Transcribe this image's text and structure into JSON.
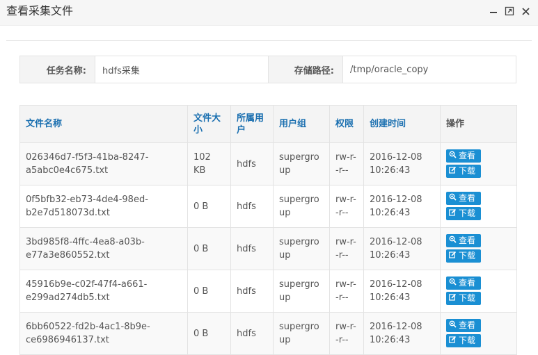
{
  "dialog": {
    "title": "查看采集文件"
  },
  "info": {
    "task_label": "任务名称:",
    "task_value": "hdfs采集",
    "path_label": "存储路径:",
    "path_value": "/tmp/oracle_copy"
  },
  "table": {
    "headers": {
      "name": "文件名称",
      "size": "文件大小",
      "owner": "所属用户",
      "group": "用户组",
      "perm": "权限",
      "ctime": "创建时间",
      "ops": "操作"
    },
    "rows": [
      {
        "name": "026346d7-f5f3-41ba-8247-a5abc0e4c675.txt",
        "size": "102 KB",
        "owner": "hdfs",
        "group": "supergroup",
        "perm": "rw-r--r--",
        "ctime": "2016-12-08 10:26:43",
        "view": "查看",
        "download": "下载"
      },
      {
        "name": "0f5bfb32-eb73-4de4-98ed-b2e7d518073d.txt",
        "size": "0 B",
        "owner": "hdfs",
        "group": "supergroup",
        "perm": "rw-r--r--",
        "ctime": "2016-12-08 10:26:43",
        "view": "查看",
        "download": "下载"
      },
      {
        "name": "3bd985f8-4ffc-4ea8-a03b-e77a3e860552.txt",
        "size": "0 B",
        "owner": "hdfs",
        "group": "supergroup",
        "perm": "rw-r--r--",
        "ctime": "2016-12-08 10:26:43",
        "view": "查看",
        "download": "下载"
      },
      {
        "name": "45916b9e-c02f-47f4-a661-e299ad274db5.txt",
        "size": "0 B",
        "owner": "hdfs",
        "group": "supergroup",
        "perm": "rw-r--r--",
        "ctime": "2016-12-08 10:26:43",
        "view": "查看",
        "download": "下载"
      },
      {
        "name": "6bb60522-fd2b-4ac1-8b9e-ce6986946137.txt",
        "size": "0 B",
        "owner": "hdfs",
        "group": "supergroup",
        "perm": "rw-r--r--",
        "ctime": "2016-12-08 10:26:43",
        "view": "查看",
        "download": "下载"
      }
    ]
  },
  "icons": {
    "minimize": "minimize-icon",
    "maximize": "maximize-icon",
    "close": "close-icon",
    "view": "zoom-icon",
    "download": "edit-icon"
  },
  "colors": {
    "header_text": "#1a6fb0",
    "button_bg": "#1a8fd3"
  }
}
